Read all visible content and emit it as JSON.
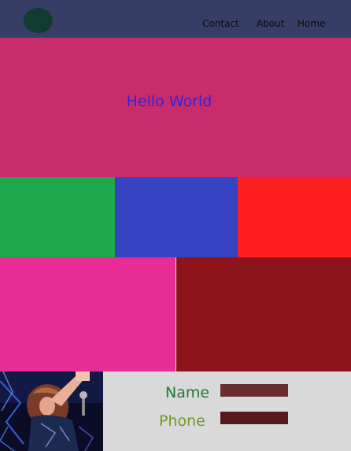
{
  "header": {
    "bg_color": "#373e66",
    "logo_color": "#0f3c2e",
    "nav": [
      {
        "label": "Contact"
      },
      {
        "label": "About"
      },
      {
        "label": "Home"
      }
    ]
  },
  "hero": {
    "title": "Hello World",
    "bg_color": "#c72d6b",
    "title_color": "#3a21d6"
  },
  "blocks": {
    "row1": [
      "#1fa74c",
      "#3643c2",
      "#ff1e1e"
    ],
    "row2": [
      "#e82d96",
      "#8e141b"
    ]
  },
  "form": {
    "name_label": "Name",
    "phone_label": "Phone",
    "name_value": "",
    "phone_value": ""
  }
}
